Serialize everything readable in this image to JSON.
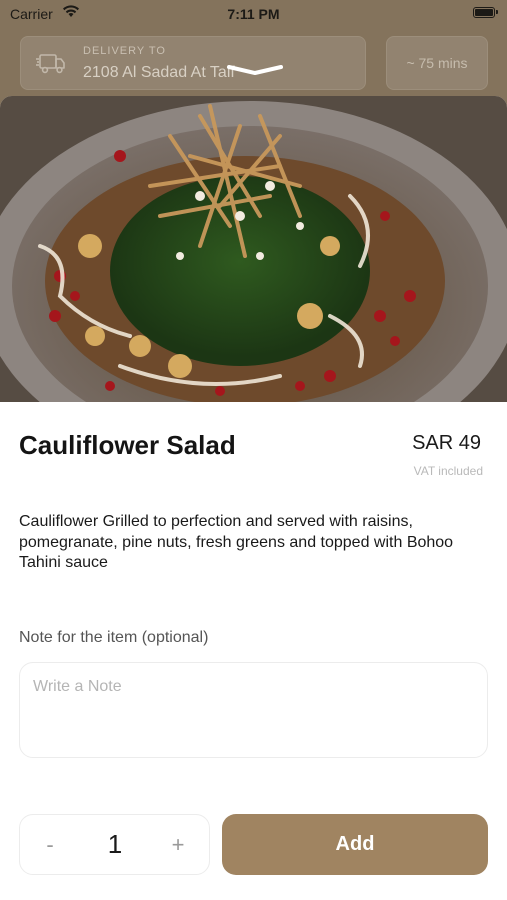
{
  "status_bar": {
    "carrier": "Carrier",
    "time": "7:11 PM"
  },
  "delivery": {
    "label": "DELIVERY TO",
    "address": "2108 Al Sadad At Taif",
    "eta": "~ 75 mins"
  },
  "item": {
    "title": "Cauliflower Salad",
    "price": "SAR 49",
    "vat_note": "VAT included",
    "description": "Cauliflower Grilled to perfection and served with raisins, pomegranate, pine nuts, fresh greens and topped with Bohoo Tahini sauce"
  },
  "note": {
    "label": "Note for the item (optional)",
    "placeholder": "Write a Note"
  },
  "quantity": {
    "minus": "-",
    "value": "1",
    "plus": "+"
  },
  "actions": {
    "add_label": "Add"
  },
  "colors": {
    "accent": "#a08461",
    "header_dim": "#84735c"
  },
  "icons": {
    "delivery": "truck-icon",
    "wifi": "wifi-icon",
    "battery": "battery-icon"
  }
}
